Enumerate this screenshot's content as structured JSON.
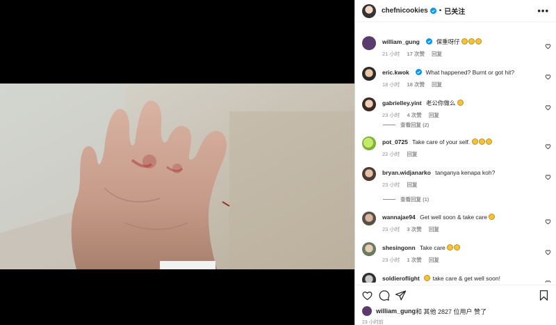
{
  "post": {
    "author": "chefnicookies",
    "follow_state": "已关注",
    "more_label": "•••",
    "liked_by_user": "william_gung",
    "likes_text": " 和 其他 2827 位用户 赞了",
    "post_time": "23 小时前",
    "colors": {
      "verified": "#0095f6",
      "meta": "#8e8e8e",
      "text": "#262626"
    }
  },
  "comments": [
    {
      "user": "william_gung",
      "verified": true,
      "text": "保重呀仔",
      "emojis": 3,
      "time": "21 小时",
      "likes": "17 次赞",
      "reply": "回复"
    },
    {
      "user": "eric.kwok",
      "verified": true,
      "text": "What happened? Burnt or got hit?",
      "emojis": 0,
      "time": "18 小时",
      "likes": "18 次赞",
      "reply": "回复"
    },
    {
      "user": "gabrielley.yint",
      "verified": false,
      "text": "老公你做么",
      "emojis": 1,
      "time": "23 小时",
      "likes": "4 次赞",
      "reply": "回复",
      "view_replies": "查看回复 (2)"
    },
    {
      "user": "pot_0725",
      "verified": false,
      "text": "Take care of your self.",
      "emojis": 3,
      "time": "22 小时",
      "likes": "",
      "reply": "回复"
    },
    {
      "user": "bryan.widjanarko",
      "verified": false,
      "text": "tanganya kenapa koh?",
      "emojis": 0,
      "time": "23 小时",
      "likes": "",
      "reply": "回复",
      "view_replies": "查看回复 (1)"
    },
    {
      "user": "wannajae94",
      "verified": false,
      "text": "Get well soon & take care",
      "emojis": 1,
      "time": "23 小时",
      "likes": "3 次赞",
      "reply": "回复"
    },
    {
      "user": "shesingonn",
      "verified": false,
      "text": "Take care",
      "emojis": 2,
      "time": "23 小时",
      "likes": "1 次赞",
      "reply": "回复"
    },
    {
      "user": "soldieroflight",
      "verified": false,
      "text": "take care & get well soon!",
      "emojis": 1,
      "time": "",
      "likes": "",
      "reply": ""
    }
  ]
}
